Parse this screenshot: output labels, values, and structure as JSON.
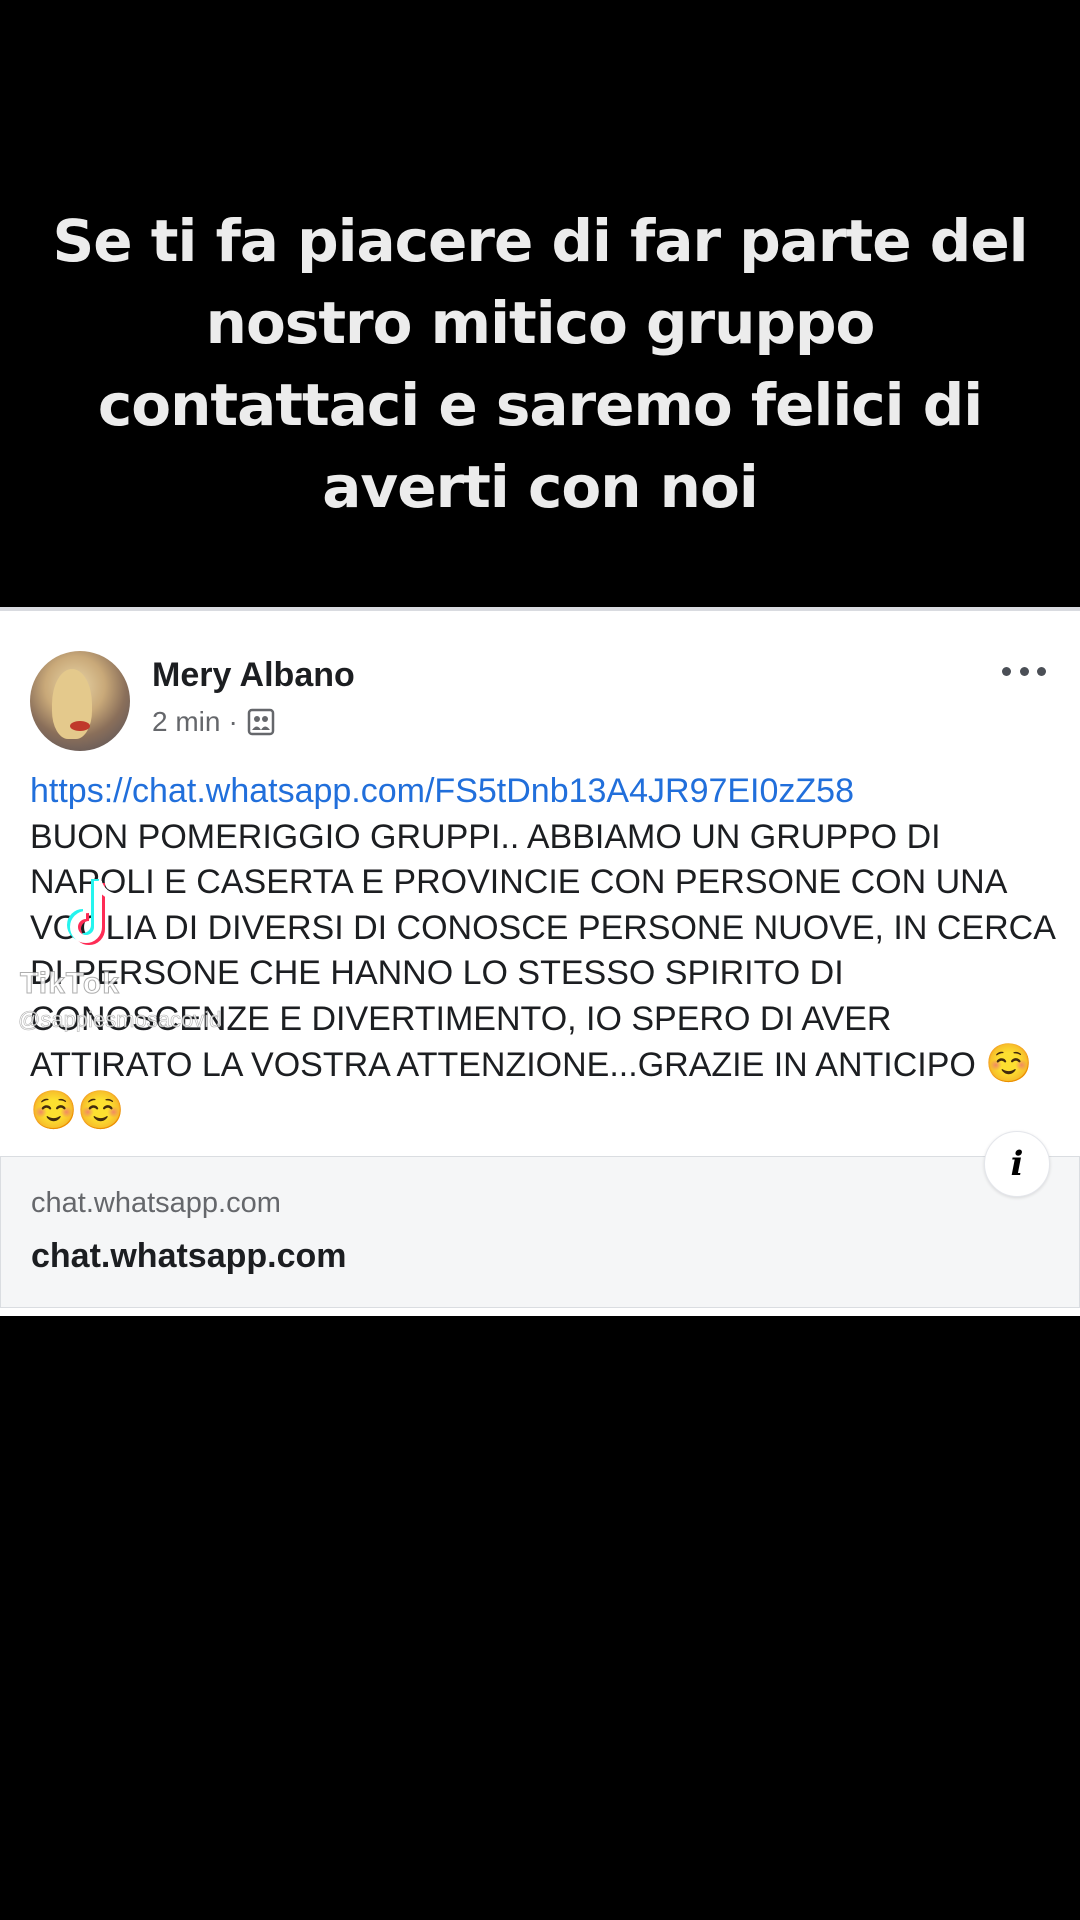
{
  "caption": {
    "text": "Se ti fa piacere di far parte del nostro mitico gruppo contattaci e saremo felici di averti con noi"
  },
  "post": {
    "author": "Mery Albano",
    "time": "2 min",
    "separator": "·",
    "audience_icon": "group-audience-icon",
    "more_icon": "more-options-icon",
    "link": "https://chat.whatsapp.com/FS5tDnb13A4JR97EI0zZ58",
    "text": "BUON POMERIGGIO GRUPPI.. ABBIAMO UN GRUPPO DI NAPOLI E CASERTA E PROVINCIE CON PERSONE CON UNA VOGLIA DI DIVERSI DI CONOSCE PERSONE NUOVE, IN CERCA DI PERSONE CHE HANNO LO STESSO SPIRITO DI CONOSCENZE E DIVERTIMENTO, IO SPERO DI AVER ATTIRATO LA VOSTRA ATTENZIONE...GRAZIE IN ANTICIPO",
    "emojis": "☺️☺️☺️"
  },
  "link_preview": {
    "domain": "chat.whatsapp.com",
    "title": "chat.whatsapp.com",
    "info_icon": "info-icon",
    "info_label": "i"
  },
  "watermark": {
    "brand": "TikTok",
    "handle": "@sappiesmosacovid"
  },
  "colors": {
    "background": "#000000",
    "caption_text": "#ececec",
    "link": "#216fdb",
    "card": "#ffffff",
    "preview_bg": "#f5f6f7"
  }
}
